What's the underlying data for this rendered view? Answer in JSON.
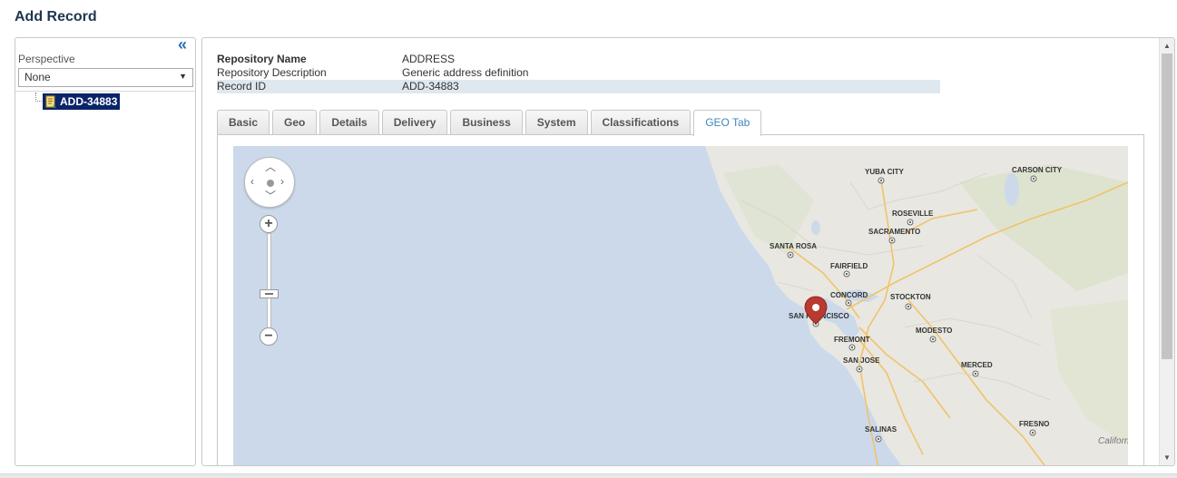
{
  "page": {
    "title": "Add Record"
  },
  "left_panel": {
    "collapse_icon": "double-chevron-left-icon",
    "perspective_label": "Perspective",
    "perspective_value": "None",
    "tree": {
      "node_label": "ADD-34883",
      "node_icon": "document-icon"
    }
  },
  "record_info": {
    "rows": [
      {
        "label": "Repository Name",
        "value": "ADDRESS"
      },
      {
        "label": "Repository Description",
        "value": "Generic address definition"
      },
      {
        "label": "Record ID",
        "value": "ADD-34883"
      }
    ]
  },
  "tabs": [
    {
      "label": "Basic"
    },
    {
      "label": "Geo"
    },
    {
      "label": "Details"
    },
    {
      "label": "Delivery"
    },
    {
      "label": "Business"
    },
    {
      "label": "System"
    },
    {
      "label": "Classifications"
    },
    {
      "label": "GEO Tab",
      "active": true
    }
  ],
  "map": {
    "cities": [
      "YUBA CITY",
      "CARSON CITY",
      "ROSEVILLE",
      "SACRAMENTO",
      "SANTA ROSA",
      "FAIRFIELD",
      "CONCORD",
      "STOCKTON",
      "SAN FRANCISCO",
      "MODESTO",
      "FREMONT",
      "SAN JOSE",
      "MERCED",
      "SALINAS",
      "FRESNO"
    ],
    "region_label": "Californ",
    "marker_icon": "map-pin-icon",
    "colors": {
      "water": "#cbd9eb",
      "land": "#e9e8e3",
      "marker": "#c0392b",
      "road": "#f1c36a"
    }
  }
}
